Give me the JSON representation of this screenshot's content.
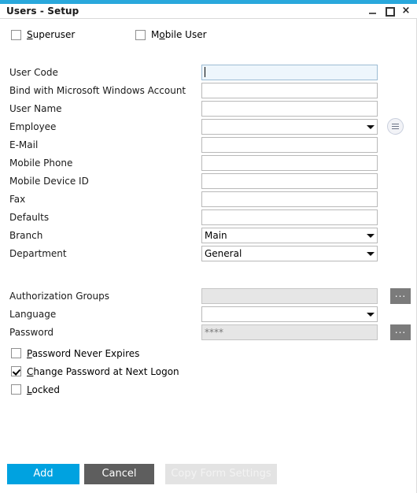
{
  "window": {
    "title": "Users - Setup",
    "controls": {
      "minimize": "minimize",
      "maximize": "maximize",
      "close": "×"
    },
    "accent_color": "#29A8DC"
  },
  "top_checkboxes": [
    {
      "label_before": "",
      "accel": "S",
      "label_after": "uperuser",
      "checked": false,
      "name": "superuser"
    },
    {
      "label_before": "M",
      "accel": "o",
      "label_after": "bile User",
      "checked": false,
      "name": "mobile-user"
    }
  ],
  "fields": [
    {
      "label": "User Code",
      "value": "",
      "type": "text",
      "state": "focused",
      "name": "user-code"
    },
    {
      "label": "Bind with Microsoft Windows Account",
      "value": "",
      "type": "text",
      "state": "normal",
      "name": "bind-windows-account"
    },
    {
      "label": "User Name",
      "value": "",
      "type": "text",
      "state": "normal",
      "name": "user-name"
    },
    {
      "label": "Employee",
      "value": "",
      "type": "select",
      "state": "normal",
      "name": "employee",
      "extra": "circle-list-button"
    },
    {
      "label": "E-Mail",
      "value": "",
      "type": "text",
      "state": "normal",
      "name": "email"
    },
    {
      "label": "Mobile Phone",
      "value": "",
      "type": "text",
      "state": "normal",
      "name": "mobile-phone"
    },
    {
      "label": "Mobile Device ID",
      "value": "",
      "type": "text",
      "state": "normal",
      "name": "mobile-device-id"
    },
    {
      "label": "Fax",
      "value": "",
      "type": "text",
      "state": "normal",
      "name": "fax"
    },
    {
      "label": "Defaults",
      "value": "",
      "type": "text",
      "state": "normal",
      "name": "defaults"
    },
    {
      "label": "Branch",
      "value": "Main",
      "type": "select",
      "state": "normal",
      "name": "branch"
    },
    {
      "label": "Department",
      "value": "General",
      "type": "select",
      "state": "normal",
      "name": "department"
    }
  ],
  "fields_lower": [
    {
      "label": "Authorization Groups",
      "value": "",
      "type": "text",
      "state": "disabled",
      "name": "authorization-groups",
      "extra": "dots-button",
      "dots_label": "..."
    },
    {
      "label": "Language",
      "value": "",
      "type": "select",
      "state": "normal",
      "name": "language"
    },
    {
      "label": "Password",
      "value": "****",
      "type": "text",
      "state": "disabled",
      "name": "password",
      "extra": "dots-button",
      "dots_label": "..."
    }
  ],
  "lower_checkboxes": [
    {
      "label_before": "",
      "accel": "P",
      "label_after": "assword Never Expires",
      "checked": false,
      "name": "password-never-expires"
    },
    {
      "label_before": "",
      "accel": "C",
      "label_after": "hange Password at Next Logon",
      "checked": true,
      "name": "change-password-next-logon"
    },
    {
      "label_before": "",
      "accel": "L",
      "label_after": "ocked",
      "checked": false,
      "name": "locked"
    }
  ],
  "footer": {
    "add_label": "Add",
    "cancel_label": "Cancel",
    "copy_label": "Copy Form Settings",
    "add_color": "#00A2E0",
    "cancel_color": "#5E5E5E",
    "copy_color": "#E3E3E3"
  }
}
